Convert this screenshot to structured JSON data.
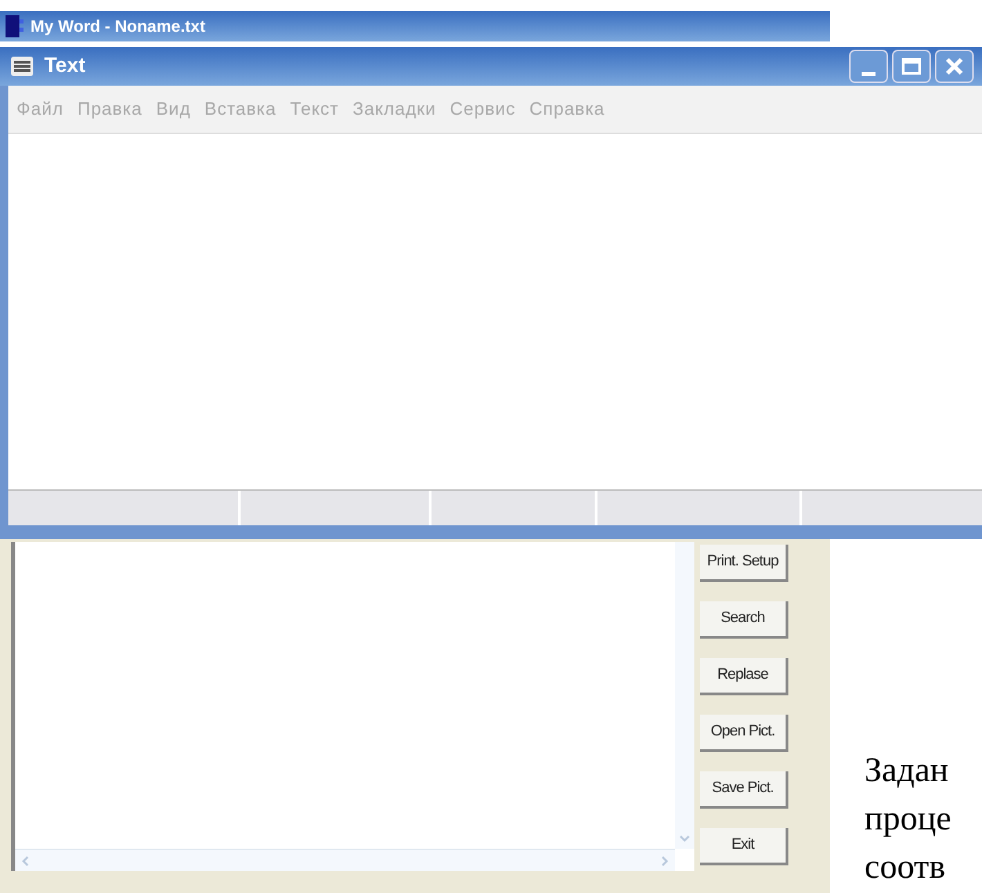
{
  "outer_window": {
    "title": "My Word - Noname.txt",
    "buttons": [
      "Print. Setup",
      "Search",
      "Replase",
      "Open Pict.",
      "Save Pict.",
      "Exit"
    ]
  },
  "text_window": {
    "title": "Text",
    "menu": [
      {
        "label": "Файл",
        "disabled": true
      },
      {
        "label": "Правка",
        "disabled": true
      },
      {
        "label": "Вид",
        "disabled": true
      },
      {
        "label": "Вставка",
        "disabled": true
      },
      {
        "label": "Текст",
        "disabled": true
      },
      {
        "label": "Закладки",
        "disabled": true
      },
      {
        "label": "Сервис",
        "disabled": true
      },
      {
        "label": "Справка",
        "disabled": true
      }
    ]
  },
  "document_lines": [
    "Задан",
    "проце",
    "соотв"
  ]
}
